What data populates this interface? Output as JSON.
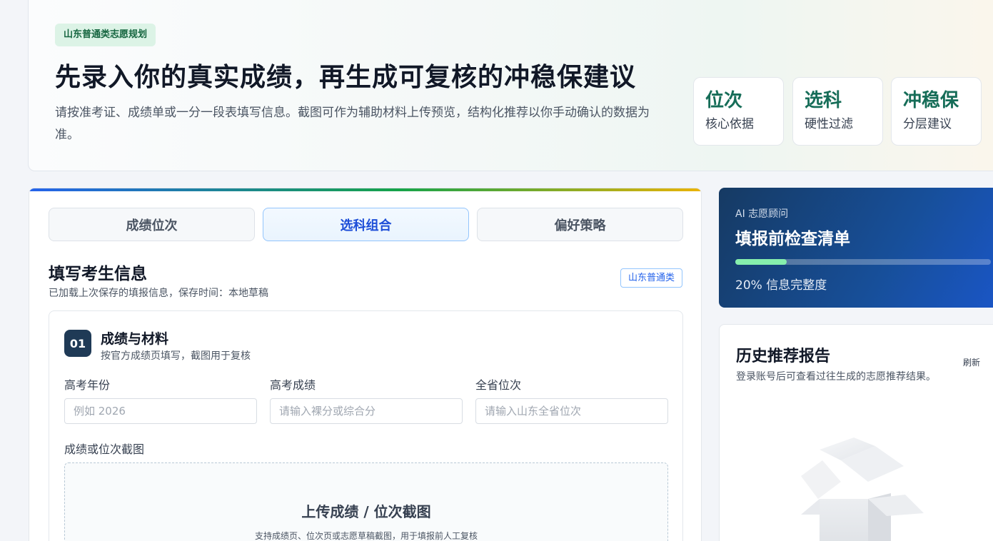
{
  "hero": {
    "badge": "山东普通类志愿规划",
    "title": "先录入你的真实成绩，再生成可复核的冲稳保建议",
    "description": "请按准考证、成绩单或一分一段表填写信息。截图可作为辅助材料上传预览，结构化推荐以你手动确认的数据为准。",
    "pills": [
      {
        "title": "位次",
        "subtitle": "核心依据"
      },
      {
        "title": "选科",
        "subtitle": "硬性过滤"
      },
      {
        "title": "冲稳保",
        "subtitle": "分层建议"
      }
    ]
  },
  "form": {
    "tabs": [
      {
        "label": "成绩位次",
        "active": false
      },
      {
        "label": "选科组合",
        "active": true
      },
      {
        "label": "偏好策略",
        "active": false
      }
    ],
    "section_title": "填写考生信息",
    "section_subtitle": "已加载上次保存的填报信息，保存时间：本地草稿",
    "region_tag": "山东普通类",
    "step": {
      "number": "01",
      "title": "成绩与材料",
      "subtitle": "按官方成绩页填写，截图用于复核"
    },
    "fields": [
      {
        "label": "高考年份",
        "value": "",
        "placeholder": "例如 2026"
      },
      {
        "label": "高考成绩",
        "value": "",
        "placeholder": "请输入裸分或综合分"
      },
      {
        "label": "全省位次",
        "value": "",
        "placeholder": "请输入山东全省位次"
      }
    ],
    "upload": {
      "label": "成绩或位次截图",
      "title": "上传成绩 / 位次截图",
      "subtitle": "支持成绩页、位次页或志愿草稿截图，用于填报前人工复核"
    }
  },
  "ai_panel": {
    "eyebrow": "AI 志愿顾问",
    "title": "填报前检查清单",
    "progress_percent": 20,
    "progress_text": "20% 信息完整度"
  },
  "history": {
    "title": "历史推荐报告",
    "subtitle": "登录账号后可查看过往生成的志愿推荐结果。",
    "refresh_label": "刷新",
    "empty_icon": "empty-box-icon"
  },
  "colors": {
    "accent_green": "#166d58",
    "accent_blue": "#1d4ed8",
    "ai_panel_bg": "#174f9a",
    "progress_fill": "#86efac"
  }
}
